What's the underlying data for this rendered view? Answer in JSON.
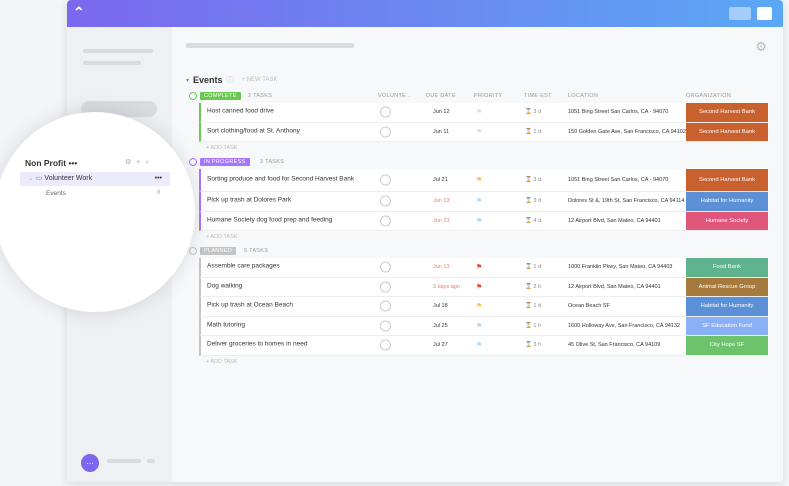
{
  "sidebar": {
    "space": "Non Profit",
    "space_more": "•••",
    "folder": "Volunteer Work",
    "folder_more": "•••",
    "list": "Events",
    "list_count": "8"
  },
  "list": {
    "title": "Events",
    "new_task": "+ NEW TASK",
    "add_task": "+ ADD TASK",
    "columns": [
      "VOLUNTE...",
      "DUE DATE",
      "PRIORITY",
      "TIME EST.",
      "LOCATION",
      "ORGANIZATION"
    ]
  },
  "groups": [
    {
      "status": "COMPLETE",
      "color": "#6bc950",
      "count": "2 TASKS",
      "tasks": [
        {
          "name": "Host canned food drive",
          "due": "Jun 12",
          "due_color": "#333",
          "priority": "none",
          "time": "3 d",
          "location": "1051 Bing Street San Carlos, CA - 94070",
          "org": "Second Harvest Bank",
          "org_color": "#c9612f"
        },
        {
          "name": "Sort clothing/food at St. Anthony",
          "due": "Jun 11",
          "due_color": "#333",
          "priority": "none",
          "time": "1 d",
          "location": "150 Golden Gate Ave, San Francisco, CA 94102",
          "org": "Second Harvest Bank",
          "org_color": "#c9612f"
        }
      ]
    },
    {
      "status": "IN PROGRESS",
      "color": "#a875ff",
      "count": "3 TASKS",
      "tasks": [
        {
          "name": "Sorting produce and food for Second Harvest Bank",
          "due": "Jul 21",
          "due_color": "#333",
          "priority": "high",
          "time": "3 d",
          "location": "1051 Bing Street San Carlos, CA - 94070",
          "org": "Second Harvest Bank",
          "org_color": "#c9612f"
        },
        {
          "name": "Pick up trash at Dolores Park",
          "due": "Jun 13",
          "due_color": "#e8805a",
          "priority": "normal",
          "time": "3 d",
          "location": "Dolores St &, 19th St, San Francisco, CA 94114",
          "org": "Habitat for Humanity",
          "org_color": "#5b8fd6"
        },
        {
          "name": "Humane Society dog food prep and feeding",
          "due": "Jun 23",
          "due_color": "#e8805a",
          "priority": "normal",
          "time": "4 d",
          "location": "12 Airport Blvd, San Mateo, CA 94401",
          "org": "Humane Society",
          "org_color": "#e0557a"
        }
      ]
    },
    {
      "status": "PLANNED",
      "color": "#c4c4c4",
      "count": "5 TASKS",
      "tasks": [
        {
          "name": "Assemble care packages",
          "due": "Jun 13",
          "due_color": "#e8805a",
          "priority": "urgent",
          "time": "1 d",
          "location": "1000 Franklin Pkwy, San Mateo, CA 94403",
          "org": "Food Bank",
          "org_color": "#5fb38f"
        },
        {
          "name": "Dog walking",
          "due": "3 days ago",
          "due_color": "#e8805a",
          "priority": "urgent",
          "time": "2 h",
          "location": "12 Airport Blvd, San Mateo, CA 94401",
          "org": "Animal Rescue Group",
          "org_color": "#a67a3c"
        },
        {
          "name": "Pick up trash at Ocean Beach",
          "due": "Jul 18",
          "due_color": "#333",
          "priority": "high",
          "time": "1 d",
          "location": "Ocean Beach SF",
          "org": "Habitat for Humanity",
          "org_color": "#5b8fd6"
        },
        {
          "name": "Math tutoring",
          "due": "Jul 25",
          "due_color": "#333",
          "priority": "normal",
          "time": "1 h",
          "location": "1600 Holloway Ave, San Francisco, CA 94132",
          "org": "SF Education Fund",
          "org_color": "#8ab0f5"
        },
        {
          "name": "Deliver groceries to homes in need",
          "due": "Jul 27",
          "due_color": "#333",
          "priority": "normal",
          "time": "3 h",
          "location": "45 Olive St, San Francisco, CA 94109",
          "org": "City Hope SF",
          "org_color": "#6cc36c"
        }
      ]
    }
  ],
  "flag_colors": {
    "none": "#ddd",
    "high": "#f7c344",
    "normal": "#a8d4f7",
    "urgent": "#e2402c"
  }
}
